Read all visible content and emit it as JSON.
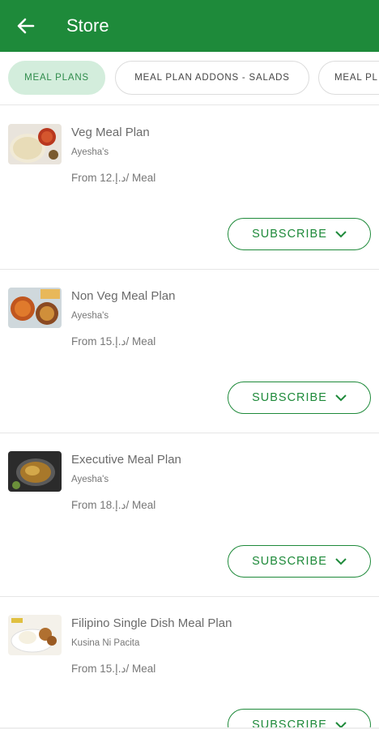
{
  "header": {
    "title": "Store",
    "back_icon": "arrow-left-icon",
    "color": "#1e8a3a"
  },
  "tabs": [
    {
      "label": "MEAL PLANS",
      "active": true
    },
    {
      "label": "MEAL PLAN ADDONS - SALADS",
      "active": false
    },
    {
      "label": "MEAL PL",
      "active": false
    }
  ],
  "plans": [
    {
      "name": "Veg Meal Plan",
      "vendor": "Ayesha's",
      "price": "From 12.د.إ/ Meal",
      "action": "SUBSCRIBE"
    },
    {
      "name": "Non Veg Meal Plan",
      "vendor": "Ayesha's",
      "price": "From 15.د.إ/ Meal",
      "action": "SUBSCRIBE"
    },
    {
      "name": "Executive Meal Plan",
      "vendor": "Ayesha's",
      "price": "From 18.د.إ/ Meal",
      "action": "SUBSCRIBE"
    },
    {
      "name": "Filipino Single Dish Meal Plan",
      "vendor": "Kusina Ni Pacita",
      "price": "From 15.د.إ/ Meal",
      "action": "SUBSCRIBE"
    }
  ]
}
